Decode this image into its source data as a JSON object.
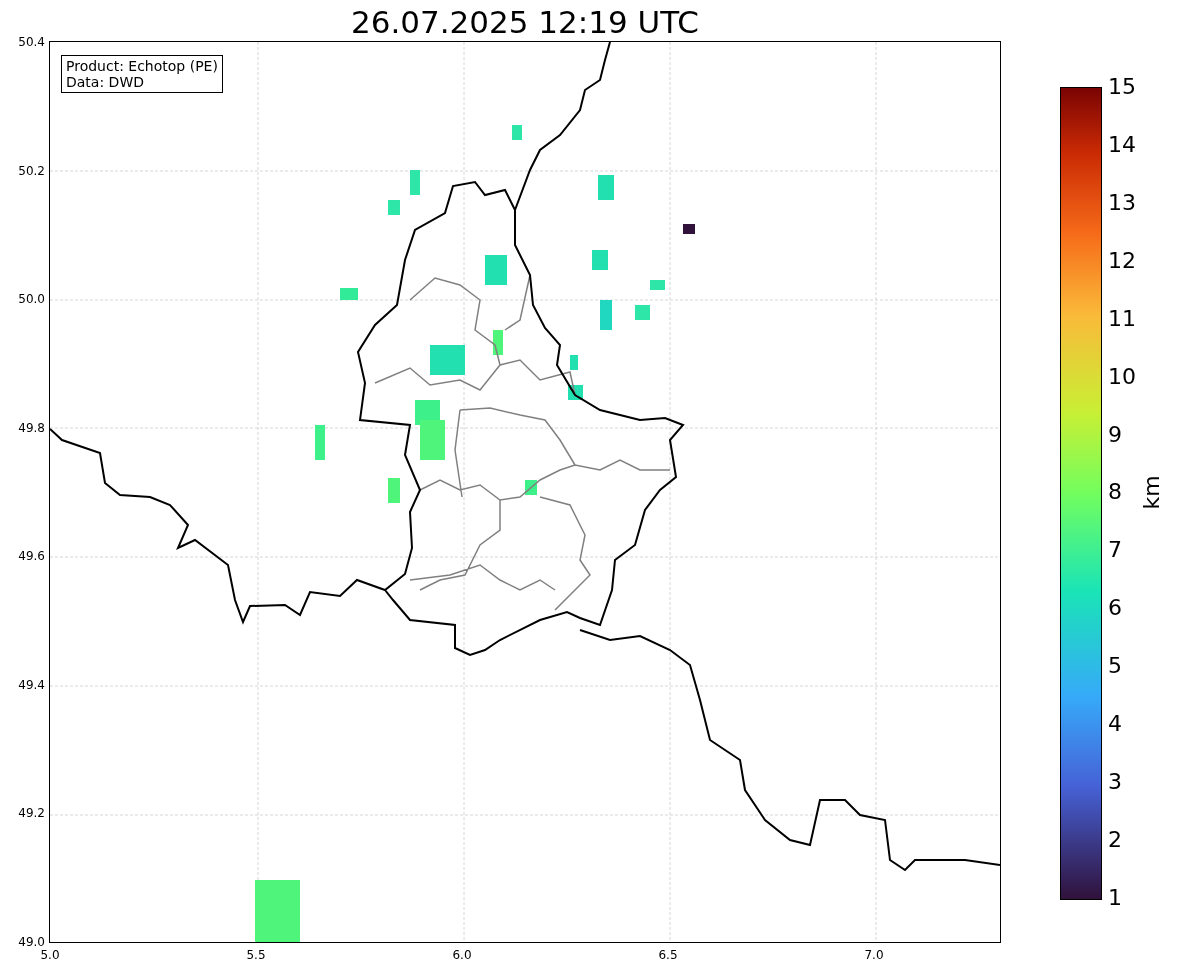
{
  "title": "26.07.2025 12:19 UTC",
  "info_box": [
    "Product: Echotop (PE)",
    "Data: DWD"
  ],
  "map": {
    "yticks": [
      "50.4",
      "50.2",
      "50.0",
      "49.8",
      "49.6",
      "49.4",
      "49.2",
      "49.0"
    ],
    "xticks": [
      "5.0",
      "5.5",
      "6.0",
      "6.5",
      "7.0"
    ]
  },
  "colorbar": {
    "label": "km",
    "ticks": [
      "15",
      "14",
      "13",
      "12",
      "11",
      "10",
      "9",
      "8",
      "7",
      "6",
      "5",
      "4",
      "3",
      "2",
      "1"
    ]
  }
}
